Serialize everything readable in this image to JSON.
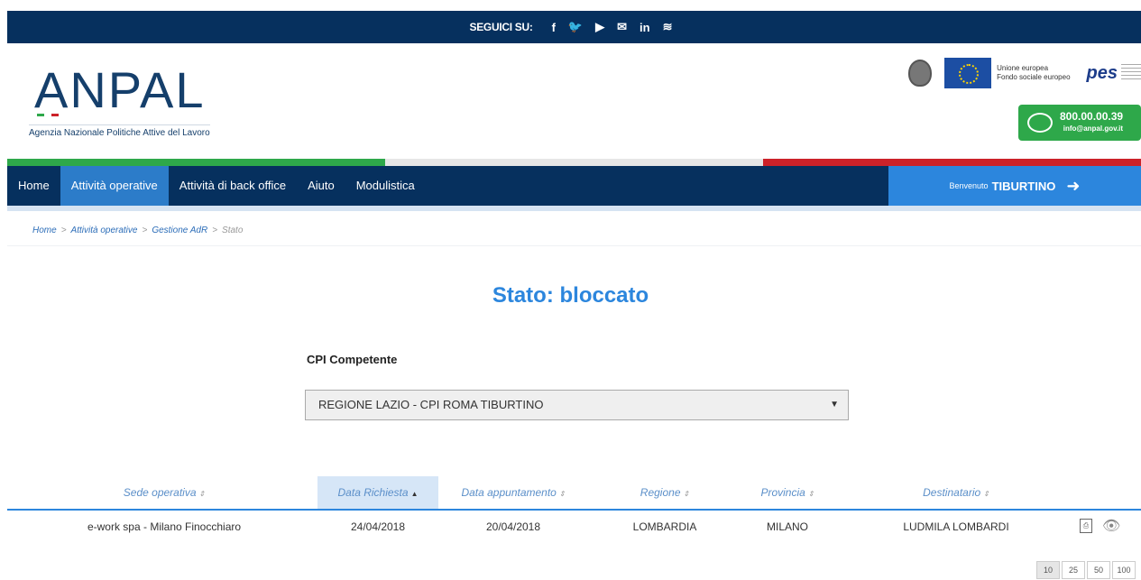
{
  "social": {
    "label": "SEGUICI SU:",
    "icons": [
      {
        "name": "facebook-icon",
        "glyph": "f"
      },
      {
        "name": "twitter-icon",
        "glyph": "🐦"
      },
      {
        "name": "youtube-icon",
        "glyph": "▶"
      },
      {
        "name": "mail-icon",
        "glyph": "✉"
      },
      {
        "name": "linkedin-icon",
        "glyph": "in"
      },
      {
        "name": "rss-icon",
        "glyph": "≋"
      }
    ]
  },
  "brand": {
    "logo_text": "ANPAL",
    "subtitle": "Agenzia Nazionale Politiche Attive del Lavoro",
    "eu_line1": "Unione europea",
    "eu_line2": "Fondo sociale europeo",
    "pes": "pes",
    "phone": "800.00.00.39",
    "email": "info@anpal.gov.it"
  },
  "colors": {
    "nav_bg": "#06305e",
    "accent": "#2c86dd",
    "green": "#2ea84a",
    "flag_green": "#2ea84a",
    "flag_white": "#e6e6e6",
    "flag_red": "#cc2229"
  },
  "nav": {
    "items": [
      {
        "label": "Home",
        "active": false
      },
      {
        "label": "Attività operative",
        "active": true
      },
      {
        "label": "Attività di back office",
        "active": false
      },
      {
        "label": "Aiuto",
        "active": false
      },
      {
        "label": "Modulistica",
        "active": false
      }
    ],
    "welcome": "Benvenuto",
    "user": "TIBURTINO",
    "logout_icon": "logout-icon"
  },
  "breadcrumb": {
    "items": [
      "Home",
      "Attività operative",
      "Gestione AdR"
    ],
    "current": "Stato"
  },
  "page": {
    "title": "Stato: bloccato",
    "cpi_label": "CPI Competente",
    "cpi_value": "REGIONE LAZIO - CPI ROMA TIBURTINO"
  },
  "table": {
    "columns": [
      {
        "label": "Sede operativa",
        "sort": "⇕"
      },
      {
        "label": "Data Richiesta",
        "sort": "▲"
      },
      {
        "label": "Data appuntamento",
        "sort": "⇕"
      },
      {
        "label": "Regione",
        "sort": "⇕"
      },
      {
        "label": "Provincia",
        "sort": "⇕"
      },
      {
        "label": "Destinatario",
        "sort": "⇕"
      }
    ],
    "rows": [
      [
        "e-work spa - Milano Finocchiaro",
        "24/04/2018",
        "20/04/2018",
        "LOMBARDIA",
        "MILANO",
        "LUDMILA LOMBARDI"
      ]
    ]
  },
  "pager": {
    "sizes": [
      "10",
      "25",
      "50",
      "100"
    ]
  }
}
